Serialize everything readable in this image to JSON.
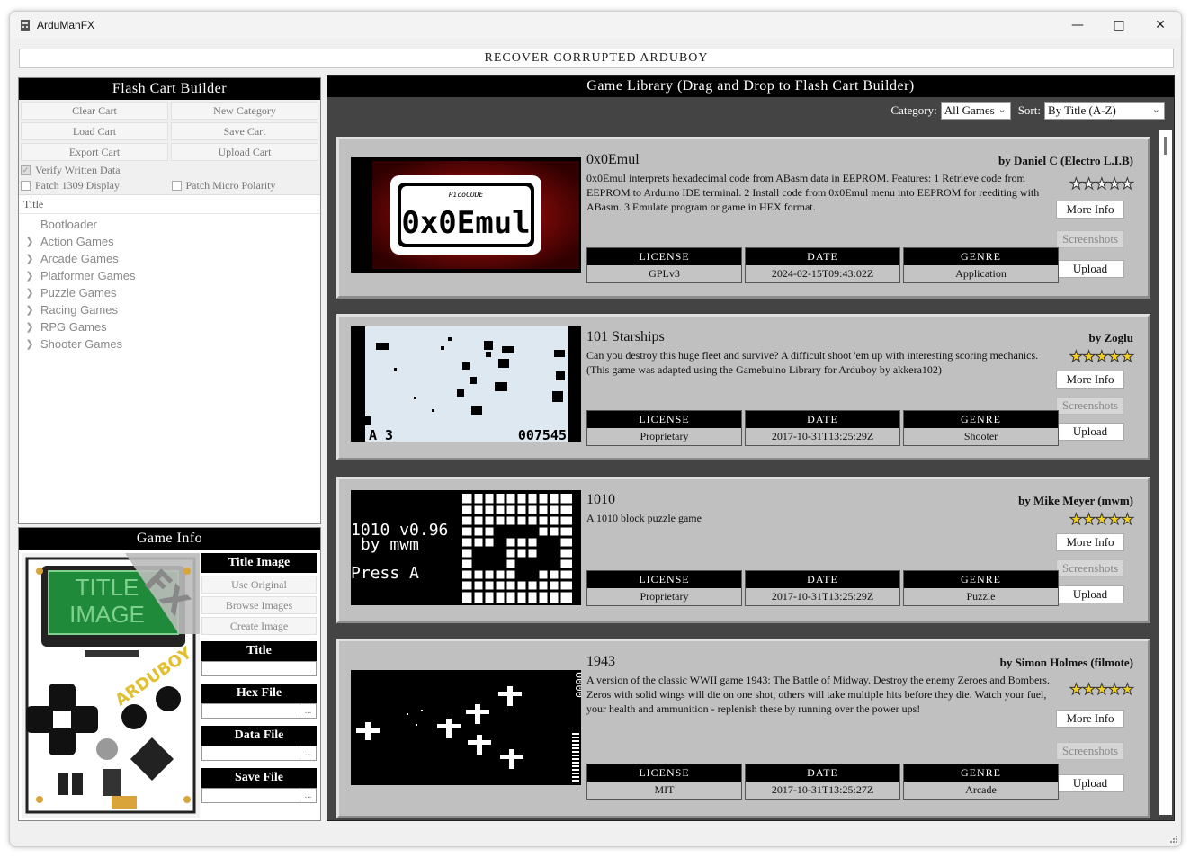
{
  "window": {
    "title": "ArduManFX"
  },
  "recover_button": "RECOVER CORRUPTED ARDUBOY",
  "flash_cart": {
    "header": "Flash Cart Builder",
    "buttons": [
      "Clear Cart",
      "New Category",
      "Load Cart",
      "Save Cart",
      "Export Cart",
      "Upload Cart"
    ],
    "checks": [
      {
        "label": "Verify Written Data",
        "checked": true
      },
      {
        "label": "Patch Micro Polarity",
        "checked": false
      },
      {
        "label": "Patch 1309 Display",
        "checked": false
      }
    ],
    "tree_header": "Title",
    "tree_items": [
      "Bootloader",
      "Action Games",
      "Arcade Games",
      "Platformer Games",
      "Puzzle Games",
      "Racing Games",
      "RPG Games",
      "Shooter Games"
    ]
  },
  "game_info": {
    "header": "Game Info",
    "title_image_label": "Title Image",
    "title_image_buttons": [
      "Use Original",
      "Browse Images",
      "Create Image"
    ],
    "placeholder_image_text": [
      "TITLE",
      "IMAGE"
    ],
    "fx_text": "FX",
    "fields": [
      "Title",
      "Hex File",
      "Data File",
      "Save File"
    ],
    "browse": "..."
  },
  "library": {
    "header": "Game Library (Drag and Drop to Flash Cart Builder)",
    "category_label": "Category:",
    "category_value": "All Games",
    "sort_label": "Sort:",
    "sort_value": "By Title (A-Z)",
    "meta_labels": [
      "LICENSE",
      "DATE",
      "GENRE"
    ],
    "buttons": [
      "More Info",
      "Screenshots",
      "Upload"
    ],
    "games": [
      {
        "title": "0x0Emul",
        "author": "by Daniel C (Electro L.I.B)",
        "description": "0x0Emul interprets hexadecimal code from ABasm data in EEPROM. Features: 1 Retrieve code from EEPROM to Arduino IDE terminal. 2 Install code from 0x0Emul menu into EEPROM for reediting with ABasm. 3 Emulate program or game in HEX format.",
        "license": "GPLv3",
        "date": "2024-02-15T09:43:02Z",
        "genre": "Application",
        "rating": 0,
        "thumb_text": "0x0Emul",
        "thumb_small": "PicoCODE"
      },
      {
        "title": "101 Starships",
        "author": "by Zoglu",
        "description": "Can you destroy this huge fleet and survive? A difficult shoot 'em up with interesting scoring mechanics. (This game was adapted using the Gamebuino Library for Arduboy by akkera102)",
        "license": "Proprietary",
        "date": "2017-10-31T13:25:29Z",
        "genre": "Shooter",
        "rating": 5,
        "thumb_left": "A 3",
        "thumb_right": "007545"
      },
      {
        "title": "1010",
        "author": "by Mike Meyer (mwm)",
        "description": "A 1010 block puzzle game",
        "license": "Proprietary",
        "date": "2017-10-31T13:25:29Z",
        "genre": "Puzzle",
        "rating": 5,
        "thumb_lines": [
          "1010 v0.96",
          " by mwm",
          "Press A"
        ]
      },
      {
        "title": "1943",
        "author": "by Simon Holmes (filmote)",
        "description": "A version of the classic WWII game 1943: The Battle of Midway. Destroy the enemy Zeroes and Bombers. Zeros with solid wings will die on one shot, others will take multiple hits before they die. Watch your fuel, your health and ammunition - replenish these by running over the power ups!",
        "license": "MIT",
        "date": "2017-10-31T13:25:27Z",
        "genre": "Arcade",
        "rating": 5,
        "thumb_score": "0000"
      }
    ]
  },
  "colors": {
    "accent_black": "#000000",
    "card_gray": "#c0c0c0",
    "library_bg": "#444444",
    "star": "#f5d020"
  }
}
